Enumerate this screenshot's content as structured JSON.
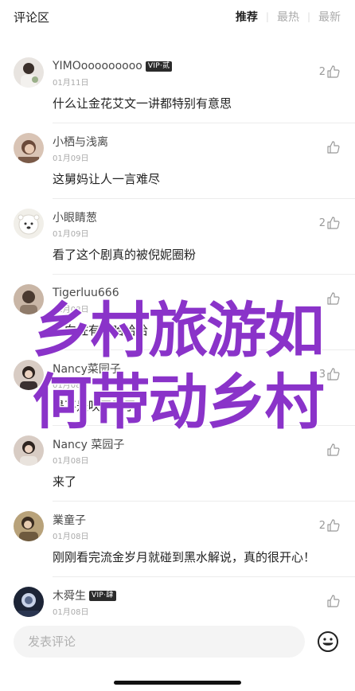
{
  "header": {
    "title": "评论区",
    "tabs": [
      {
        "label": "推荐",
        "active": true
      },
      {
        "label": "最热",
        "active": false
      },
      {
        "label": "最新",
        "active": false
      }
    ]
  },
  "comments": [
    {
      "name": "YIMOooooooooo",
      "vip": "VIP·贰",
      "date": "01月11日",
      "text": "什么让金花艾文一讲都特别有意思",
      "likes": "2"
    },
    {
      "name": "小栖与浅离",
      "vip": "",
      "date": "01月09日",
      "text": "这舅妈让人一言难尽",
      "likes": ""
    },
    {
      "name": "小眼睛葱",
      "vip": "",
      "date": "01月09日",
      "text": "看了这个剧真的被倪妮圈粉",
      "likes": "2"
    },
    {
      "name": "Tigerluu666",
      "vip": "",
      "date": "01月08日",
      "text": "这向佐有哈哈哈哈",
      "likes": ""
    },
    {
      "name": "Nancy菜园子",
      "vip": "",
      "date": "01月08日",
      "text": "是不是吹了啊了",
      "likes": "3"
    },
    {
      "name": "Nancy 菜园子",
      "vip": "",
      "date": "01月08日",
      "text": "来了",
      "likes": ""
    },
    {
      "name": "業童子",
      "vip": "",
      "date": "01月08日",
      "text": "刚刚看完流金岁月就碰到黑水解说，真的很开心！",
      "likes": "2"
    },
    {
      "name": "木舜生",
      "vip": "VIP·肆",
      "date": "01月08日",
      "text": "",
      "likes": ""
    }
  ],
  "overlay": {
    "line1": "乡村旅游如",
    "line2": "何带动乡村"
  },
  "composer": {
    "placeholder": "发表评论"
  },
  "colors": {
    "overlay_text": "#8a33c9",
    "vip_badge": "#2b2b2b"
  }
}
